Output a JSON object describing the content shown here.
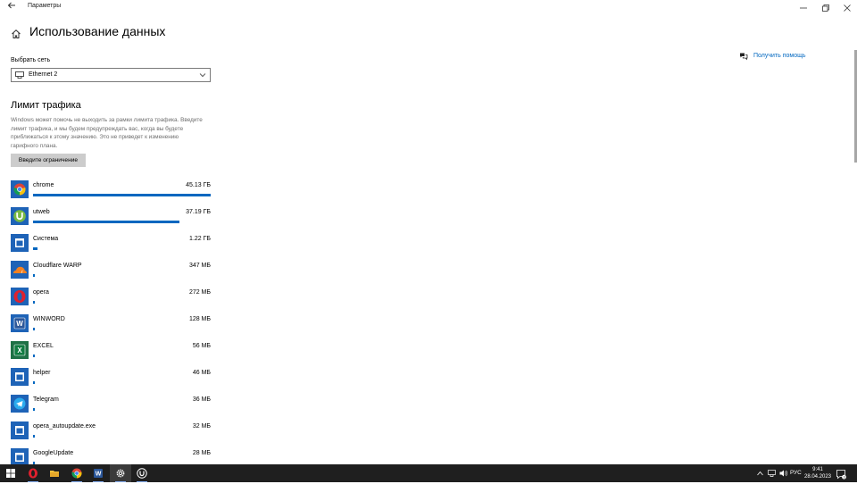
{
  "window": {
    "title": "Параметры",
    "back_icon": "back-arrow-icon",
    "controls": [
      "minimize-icon",
      "maximize-icon",
      "close-icon"
    ]
  },
  "header": {
    "title": "Использование данных",
    "home_icon": "home-icon"
  },
  "help": {
    "label": "Получить помощь",
    "icon": "help-chat-icon"
  },
  "network": {
    "label": "Выбрать сеть",
    "selected": "Ethernet 2",
    "icon": "ethernet-icon"
  },
  "limit": {
    "title": "Лимит трафика",
    "description": "Windows может помочь не выходить за рамки лимита трафика. Введите лимит трафика, и мы будем предупреждать вас, когда вы будете приближаться к этому значению. Это не приведет к изменению гарифного плана.",
    "button": "Введите ограничение"
  },
  "accent_color": "#0067c0",
  "apps": [
    {
      "name": "chrome",
      "size": "45.13 ГБ",
      "usage_fraction": 1.0,
      "icon": "chrome-icon"
    },
    {
      "name": "utweb",
      "size": "37.19 ГБ",
      "usage_fraction": 0.824,
      "icon": "utorrent-icon"
    },
    {
      "name": "Система",
      "size": "1.22 ГБ",
      "usage_fraction": 0.027,
      "icon": "system-app-icon"
    },
    {
      "name": "Cloudflare WARP",
      "size": "347 МБ",
      "usage_fraction": 0.0077,
      "icon": "cloudflare-icon"
    },
    {
      "name": "opera",
      "size": "272 МБ",
      "usage_fraction": 0.006,
      "icon": "opera-icon"
    },
    {
      "name": "WINWORD",
      "size": "128 МБ",
      "usage_fraction": 0.0028,
      "icon": "word-icon"
    },
    {
      "name": "EXCEL",
      "size": "56 МБ",
      "usage_fraction": 0.0012,
      "icon": "excel-icon"
    },
    {
      "name": "helper",
      "size": "46 МБ",
      "usage_fraction": 0.001,
      "icon": "generic-app-icon"
    },
    {
      "name": "Telegram",
      "size": "36 МБ",
      "usage_fraction": 0.0008,
      "icon": "telegram-icon"
    },
    {
      "name": "opera_autoupdate.exe",
      "size": "32 МБ",
      "usage_fraction": 0.0007,
      "icon": "generic-app-icon"
    },
    {
      "name": "GoogleUpdate",
      "size": "28 МБ",
      "usage_fraction": 0.0006,
      "icon": "generic-app-icon"
    }
  ],
  "taskbar": {
    "items": [
      "windows-start-icon",
      "opera-icon",
      "file-explorer-icon",
      "chrome-icon",
      "word-icon",
      "settings-icon",
      "utorrent-icon"
    ],
    "tray_language": "РУС",
    "time": "9:41",
    "date": "28.04.2023",
    "notification_count": "3"
  }
}
